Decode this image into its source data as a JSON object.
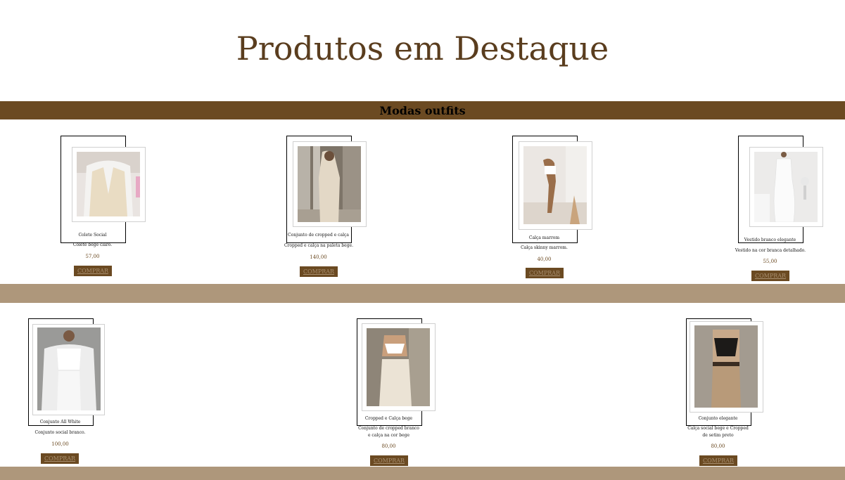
{
  "page": {
    "title": "Produtos em Destaque"
  },
  "section": {
    "title": "Modas outfits"
  },
  "colors": {
    "brand": "#6b4a22",
    "divider": "#ae977b",
    "title": "#5a3d1e"
  },
  "products": [
    {
      "name": "Colete Social",
      "desc": "Colete bege claro.",
      "price": "57,00",
      "buy": "COMPRAR"
    },
    {
      "name": "Conjunto de cropped e calça",
      "desc": "Cropped e calça na paleta bege.",
      "price": "140,00",
      "buy": "COMPRAR"
    },
    {
      "name": "Calça marrom",
      "desc": "Calça skinny marrom.",
      "price": "40,00",
      "buy": "COMPRAR"
    },
    {
      "name": "Vestido branco elegante",
      "desc": "Vestido na cor branca detalhado.",
      "price": "55,00",
      "buy": "COMPRAR"
    },
    {
      "name": "Conjunto All White",
      "desc": "Conjunto social branco.",
      "price": "100,00",
      "buy": "COMPRAR"
    },
    {
      "name": "Cropped e Calça bege",
      "desc": "Conjunto de cropped branco e calça na cor bege",
      "price": "80,00",
      "buy": "COMPRAR"
    },
    {
      "name": "Conjunto elegante",
      "desc": "Calça social bege e Cropped de setim preto",
      "price": "80,00",
      "buy": "COMPRAR"
    }
  ]
}
